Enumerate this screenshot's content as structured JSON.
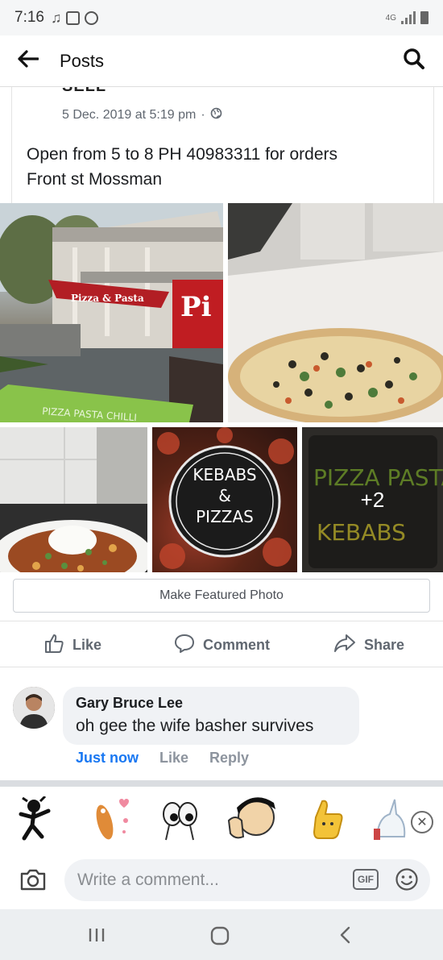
{
  "status_bar": {
    "time": "7:16",
    "network": "4G"
  },
  "header": {
    "title": "Posts"
  },
  "post": {
    "cut_title": "SELL",
    "timestamp": "5 Dec. 2019 at 5:19 pm",
    "separator": "·",
    "body_line1": "Open from 5 to 8 PH 40983311 for orders",
    "body_line2": "Front st Mossman",
    "photos": {
      "storefront_sign": "Pizza & Pasta",
      "storefront_big_sign": "Pi",
      "banner": "PIZZA PASTA CHILLI",
      "logo_line1": "KEBABS",
      "logo_line2": "&",
      "logo_line3": "PIZZAS",
      "more_count": "+2",
      "chalk_line1": "PIZZA PASTA",
      "chalk_line2": "KEBABS"
    },
    "featured_label": "Make Featured Photo"
  },
  "actions": {
    "like": "Like",
    "comment": "Comment",
    "share": "Share"
  },
  "comment": {
    "author": "Gary Bruce Lee",
    "text": "oh gee the wife basher survives",
    "time": "Just now",
    "like": "Like",
    "reply": "Reply"
  },
  "composer": {
    "placeholder": "Write a comment...",
    "gif_label": "GIF"
  },
  "colors": {
    "link": "#1877f2",
    "muted": "#606770",
    "bubble": "#f0f2f5"
  }
}
